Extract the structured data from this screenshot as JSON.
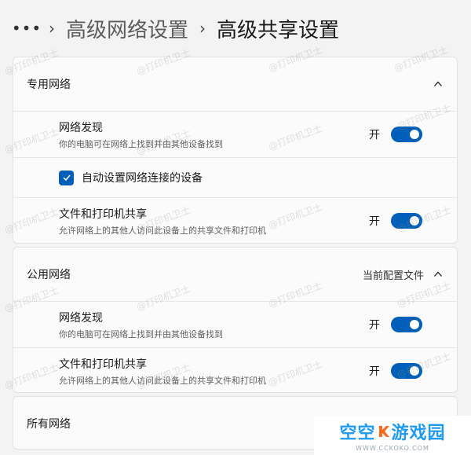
{
  "breadcrumb": {
    "more": "•••",
    "sep": "›",
    "parent": "高级网络设置",
    "current": "高级共享设置"
  },
  "private_network": {
    "title": "专用网络",
    "discovery": {
      "label": "网络发现",
      "desc": "你的电脑可在网络上找到并由其他设备找到",
      "state": "开"
    },
    "auto_setup": {
      "label": "自动设置网络连接的设备"
    },
    "file_sharing": {
      "label": "文件和打印机共享",
      "desc": "允许网络上的其他人访问此设备上的共享文件和打印机",
      "state": "开"
    }
  },
  "public_network": {
    "title": "公用网络",
    "tag": "当前配置文件",
    "discovery": {
      "label": "网络发现",
      "desc": "你的电脑可在网络上找到并由其他设备找到",
      "state": "开"
    },
    "file_sharing": {
      "label": "文件和打印机共享",
      "desc": "允许网络上的其他人访问此设备上的共享文件和打印机",
      "state": "开"
    }
  },
  "all_networks": {
    "title": "所有网络"
  },
  "watermark": "@打印机卫士",
  "logo": {
    "name_a": "空空",
    "name_b": "游戏园",
    "url": "WWW.CCKOKO.COM"
  },
  "colors": {
    "accent": "#005fb8",
    "background": "#f3f3f3",
    "card": "#fbfbfb"
  }
}
